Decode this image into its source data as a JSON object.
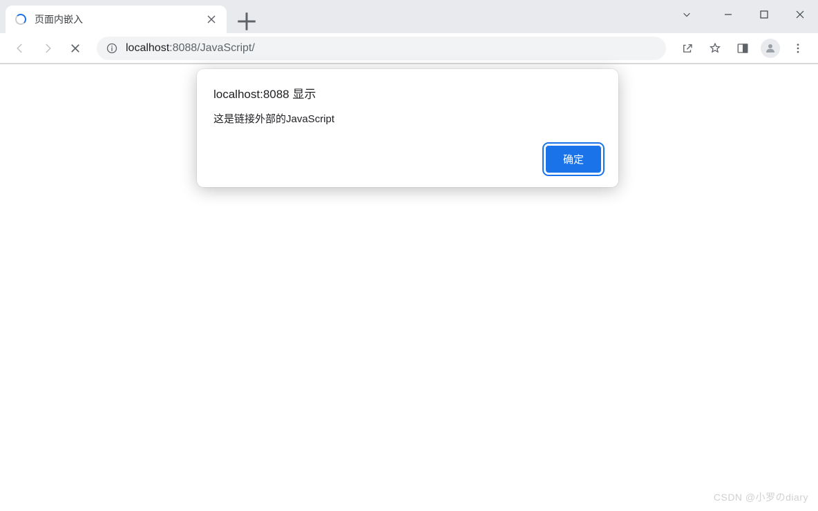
{
  "tab": {
    "title": "页面内嵌入"
  },
  "url": {
    "host": "localhost",
    "port": ":8088",
    "path": "/JavaScript/"
  },
  "alert": {
    "title": "localhost:8088 显示",
    "message": "这是链接外部的JavaScript",
    "ok_label": "确定"
  },
  "watermark": "CSDN @小罗のdiary"
}
